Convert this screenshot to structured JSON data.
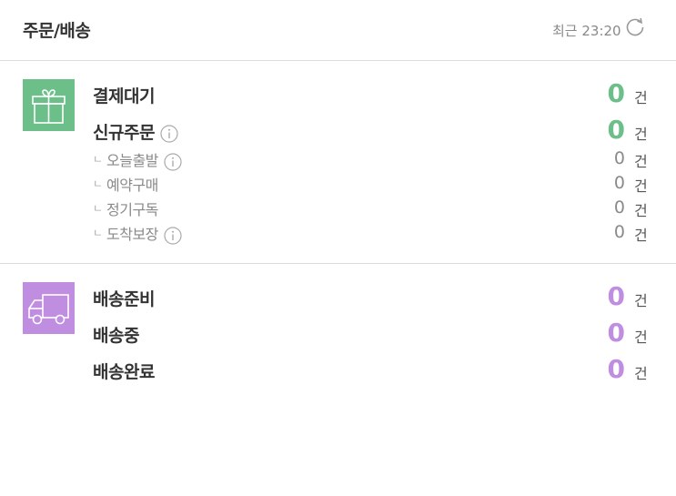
{
  "header": {
    "title": "주문/배송",
    "time": "최근 23:20"
  },
  "orders": {
    "payment_wait": {
      "label": "결제대기",
      "count": "0",
      "unit": "건"
    },
    "new_order": {
      "label": "신규주문",
      "count": "0",
      "unit": "건"
    },
    "today_ship": {
      "label": "오늘출발",
      "count": "0",
      "unit": "건"
    },
    "reservation": {
      "label": "예약구매",
      "count": "0",
      "unit": "건"
    },
    "subscription": {
      "label": "정기구독",
      "count": "0",
      "unit": "건"
    },
    "arrival_guarantee": {
      "label": "도착보장",
      "count": "0",
      "unit": "건"
    },
    "branch_glyph": "ㄴ"
  },
  "shipping": {
    "preparing": {
      "label": "배송준비",
      "count": "0",
      "unit": "건"
    },
    "in_transit": {
      "label": "배송중",
      "count": "0",
      "unit": "건"
    },
    "completed": {
      "label": "배송완료",
      "count": "0",
      "unit": "건"
    }
  },
  "colors": {
    "green": "#6dbf8a",
    "purple": "#c08ee0"
  },
  "icons": {
    "orders": "gift-icon",
    "shipping": "truck-icon",
    "refresh": "refresh-icon",
    "info": "info-icon"
  }
}
